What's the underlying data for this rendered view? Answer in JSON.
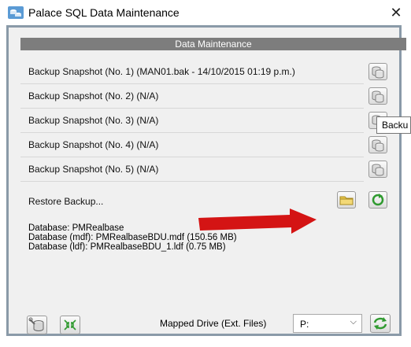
{
  "window": {
    "title": "Palace SQL Data Maintenance",
    "close_glyph": "✕"
  },
  "panel": {
    "header": "Data Maintenance"
  },
  "backups": [
    {
      "label": "Backup Snapshot (No. 1) (MAN01.bak - 14/10/2015 01:19 p.m.)"
    },
    {
      "label": "Backup Snapshot (No. 2) (N/A)"
    },
    {
      "label": "Backup Snapshot (No. 3) (N/A)"
    },
    {
      "label": "Backup Snapshot (No. 4) (N/A)"
    },
    {
      "label": "Backup Snapshot (No. 5) (N/A)"
    }
  ],
  "restore": {
    "label": "Restore Backup..."
  },
  "tooltip": {
    "text": "Backu"
  },
  "info": {
    "database": "Database: PMRealbase",
    "mdf": "Database (mdf): PMRealbaseBDU.mdf (150.56 MB)",
    "ldf": "Database (ldf): PMRealbaseBDU_1.ldf (0.75 MB)"
  },
  "footer": {
    "mapped_drive_label": "Mapped Drive (Ext. Files)",
    "drive_value": "P:"
  },
  "colors": {
    "header_bg": "#7d7d7d",
    "panel_border": "#8a9aa8",
    "arrow_red": "#d41414",
    "green_icon": "#2f9a2f",
    "folder_yellow": "#e9c74a"
  },
  "icons": [
    "database-icon",
    "close-icon",
    "backup-db-icon",
    "folder-icon",
    "restore-icon",
    "red-arrow",
    "db-tool-icon",
    "compress-icon",
    "refresh-icon",
    "chevron-down-icon"
  ]
}
